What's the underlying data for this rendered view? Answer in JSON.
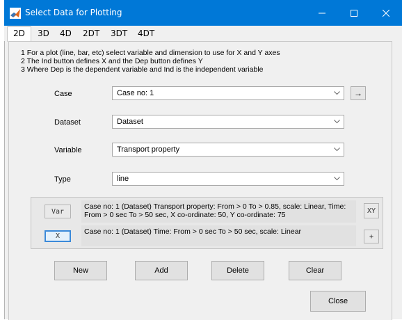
{
  "window": {
    "title": "Select Data for Plotting"
  },
  "tabs": [
    "2D",
    "3D",
    "4D",
    "2DT",
    "3DT",
    "4DT"
  ],
  "active_tab": "2D",
  "instructions": [
    "1 For a plot (line, bar, etc) select variable and dimension to use for X and Y axes",
    "2 The Ind button defines X and the Dep button defines Y",
    "3 Where Dep is the dependent variable and Ind is the independent variable"
  ],
  "fields": {
    "case": {
      "label": "Case",
      "value": "Case no: 1"
    },
    "dataset": {
      "label": "Dataset",
      "value": "Dataset"
    },
    "variable": {
      "label": "Variable",
      "value": "Transport property"
    },
    "type": {
      "label": "Type",
      "value": "line"
    }
  },
  "arrow_button": "→",
  "selection": {
    "var_button": "Var",
    "x_button": "X",
    "xy_button": "XY",
    "plus_button": "+",
    "var_info": "Case no: 1 (Dataset) Transport property: From > 0 To > 0.85, scale: Linear, Time: From > 0 sec To > 50 sec, X co-ordinate: 50, Y co-ordinate: 75",
    "x_info": "Case no: 1 (Dataset) Time: From > 0 sec To > 50 sec, scale: Linear"
  },
  "buttons": {
    "new": "New",
    "add": "Add",
    "delete": "Delete",
    "clear": "Clear",
    "close": "Close"
  },
  "colors": {
    "titlebar": "#0078d7",
    "selected_border": "#3b8ad9"
  }
}
